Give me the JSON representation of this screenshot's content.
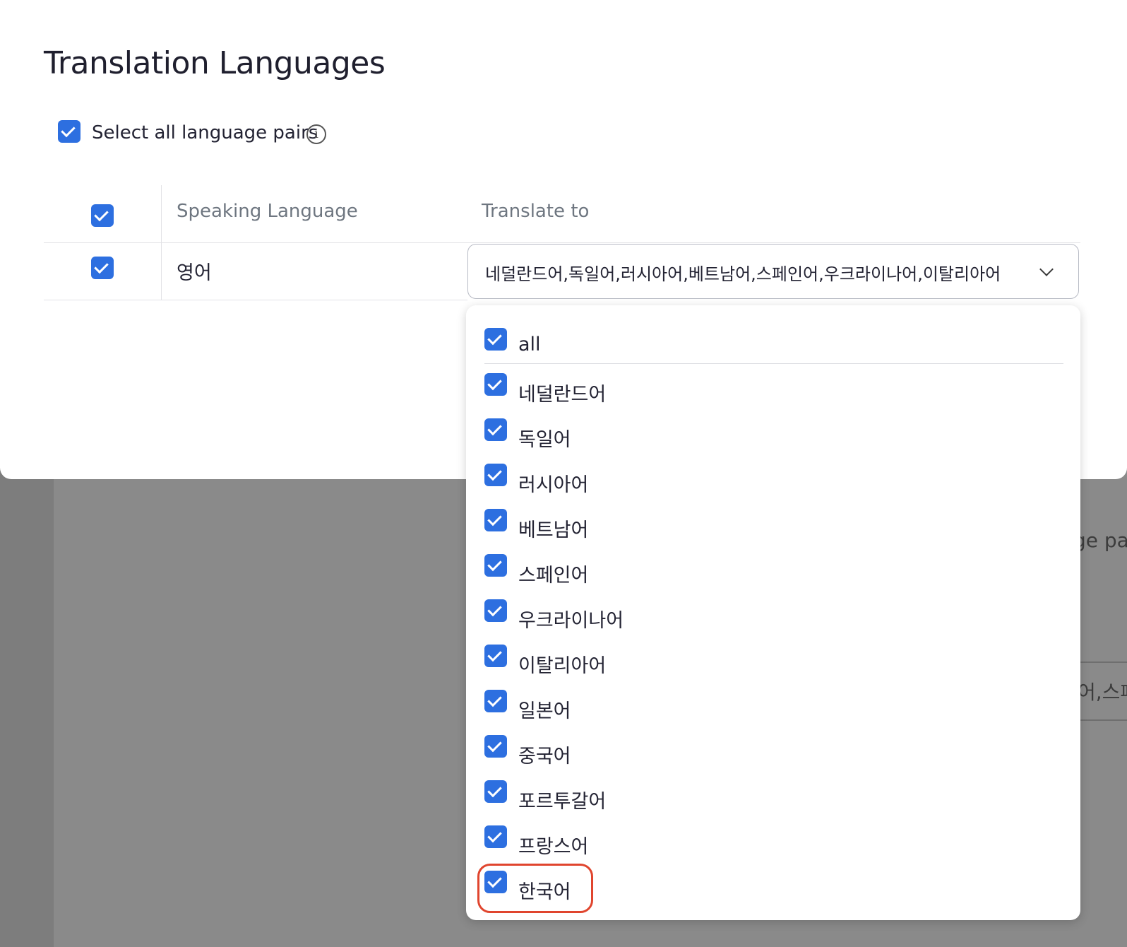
{
  "background": {
    "partial_text_1": "ge pai",
    "partial_text_2": "어,스페"
  },
  "modal": {
    "title": "Translation Languages",
    "select_all": {
      "label": "Select all language pairs",
      "checked": true,
      "info_icon": "info-icon"
    },
    "table": {
      "headers": {
        "speaking": "Speaking Language",
        "translate_to": "Translate to"
      },
      "rows": [
        {
          "checked": true,
          "speaking": "영어",
          "translate_to": "네덜란드어,독일어,러시아어,베트남어,스페인어,우크라이나어,이탈리아어"
        }
      ]
    }
  },
  "dropdown": {
    "options": [
      {
        "label": "all",
        "checked": true
      },
      {
        "label": "네덜란드어",
        "checked": true
      },
      {
        "label": "독일어",
        "checked": true
      },
      {
        "label": "러시아어",
        "checked": true
      },
      {
        "label": "베트남어",
        "checked": true
      },
      {
        "label": "스페인어",
        "checked": true
      },
      {
        "label": "우크라이나어",
        "checked": true
      },
      {
        "label": "이탈리아어",
        "checked": true
      },
      {
        "label": "일본어",
        "checked": true
      },
      {
        "label": "중국어",
        "checked": true
      },
      {
        "label": "포르투갈어",
        "checked": true
      },
      {
        "label": "프랑스어",
        "checked": true
      },
      {
        "label": "한국어",
        "checked": true
      }
    ]
  },
  "colors": {
    "accent": "#2d6fe0",
    "highlight": "#e0452e"
  }
}
